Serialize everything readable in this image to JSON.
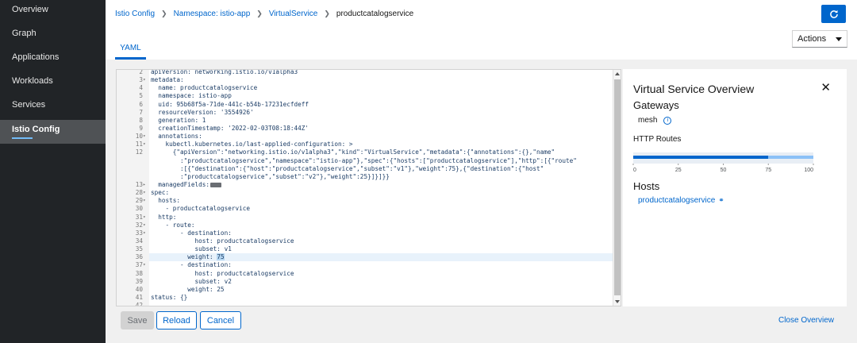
{
  "sidebar": {
    "items": [
      {
        "label": "Overview",
        "active": false
      },
      {
        "label": "Graph",
        "active": false
      },
      {
        "label": "Applications",
        "active": false
      },
      {
        "label": "Workloads",
        "active": false
      },
      {
        "label": "Services",
        "active": false
      },
      {
        "label": "Istio Config",
        "active": true
      }
    ]
  },
  "breadcrumb": {
    "items": [
      "Istio Config",
      "Namespace: istio-app",
      "VirtualService"
    ],
    "current": "productcatalogservice"
  },
  "header": {
    "actions_label": "Actions",
    "tab_label": "YAML",
    "refresh_icon": "refresh-icon"
  },
  "editor": {
    "lines": [
      {
        "n": "2",
        "fold": "",
        "text": "apiVersion: networking.istio.io/v1alpha3"
      },
      {
        "n": "3",
        "fold": "▾",
        "text": "metadata:"
      },
      {
        "n": "4",
        "fold": "",
        "text": "  name: productcatalogservice"
      },
      {
        "n": "5",
        "fold": "",
        "text": "  namespace: istio-app"
      },
      {
        "n": "6",
        "fold": "",
        "text": "  uid: 95b68f5a-71de-441c-b54b-17231ecfdeff"
      },
      {
        "n": "7",
        "fold": "",
        "text": "  resourceVersion: '3554926'"
      },
      {
        "n": "8",
        "fold": "",
        "text": "  generation: 1"
      },
      {
        "n": "9",
        "fold": "",
        "text": "  creationTimestamp: '2022-02-03T08:18:44Z'"
      },
      {
        "n": "10",
        "fold": "▾",
        "text": "  annotations:"
      },
      {
        "n": "11",
        "fold": "▾",
        "text": "    kubectl.kubernetes.io/last-applied-configuration: >"
      },
      {
        "n": "12",
        "fold": "",
        "text": "      {\"apiVersion\":\"networking.istio.io/v1alpha3\",\"kind\":\"VirtualService\",\"metadata\":{\"annotations\":{},\"name\""
      },
      {
        "n": "",
        "fold": "",
        "text": "        :\"productcatalogservice\",\"namespace\":\"istio-app\"},\"spec\":{\"hosts\":[\"productcatalogservice\"],\"http\":[{\"route\""
      },
      {
        "n": "",
        "fold": "",
        "text": "        :[{\"destination\":{\"host\":\"productcatalogservice\",\"subset\":\"v1\"},\"weight\":75},{\"destination\":{\"host\""
      },
      {
        "n": "",
        "fold": "",
        "text": "        :\"productcatalogservice\",\"subset\":\"v2\"},\"weight\":25}]}]}}"
      },
      {
        "n": "13",
        "fold": "▸",
        "text": "  managedFields:",
        "badge": true
      },
      {
        "n": "28",
        "fold": "▾",
        "text": "spec:"
      },
      {
        "n": "29",
        "fold": "▾",
        "text": "  hosts:"
      },
      {
        "n": "30",
        "fold": "",
        "text": "    - productcatalogservice"
      },
      {
        "n": "31",
        "fold": "▾",
        "text": "  http:"
      },
      {
        "n": "32",
        "fold": "▾",
        "text": "    - route:"
      },
      {
        "n": "33",
        "fold": "▾",
        "text": "        - destination:"
      },
      {
        "n": "34",
        "fold": "",
        "text": "            host: productcatalogservice"
      },
      {
        "n": "35",
        "fold": "",
        "text": "            subset: v1"
      },
      {
        "n": "36",
        "fold": "",
        "text": "          weight: ",
        "sel": "75",
        "hl": true
      },
      {
        "n": "37",
        "fold": "▾",
        "text": "        - destination:"
      },
      {
        "n": "38",
        "fold": "",
        "text": "            host: productcatalogservice"
      },
      {
        "n": "39",
        "fold": "",
        "text": "            subset: v2"
      },
      {
        "n": "40",
        "fold": "",
        "text": "          weight: 25"
      },
      {
        "n": "41",
        "fold": "",
        "text": "status: {}"
      },
      {
        "n": "42",
        "fold": "",
        "text": ""
      }
    ]
  },
  "overview": {
    "title": "Virtual Service Overview",
    "gateways_heading": "Gateways",
    "gateway": "mesh",
    "http_routes_heading": "HTTP Routes",
    "hosts_heading": "Hosts",
    "host_link": "productcatalogservice"
  },
  "chart_data": {
    "type": "bar",
    "orientation": "horizontal",
    "stacked": true,
    "categories": [
      ""
    ],
    "series": [
      {
        "values": [
          75
        ],
        "color": "#0066cc"
      },
      {
        "values": [
          25
        ],
        "color": "#8bc1f7"
      }
    ],
    "xlim": [
      0,
      100
    ],
    "xticks": [
      "0",
      "25",
      "50",
      "75",
      "100"
    ]
  },
  "footer": {
    "save_label": "Save",
    "reload_label": "Reload",
    "cancel_label": "Cancel",
    "close_overview_label": "Close Overview"
  }
}
